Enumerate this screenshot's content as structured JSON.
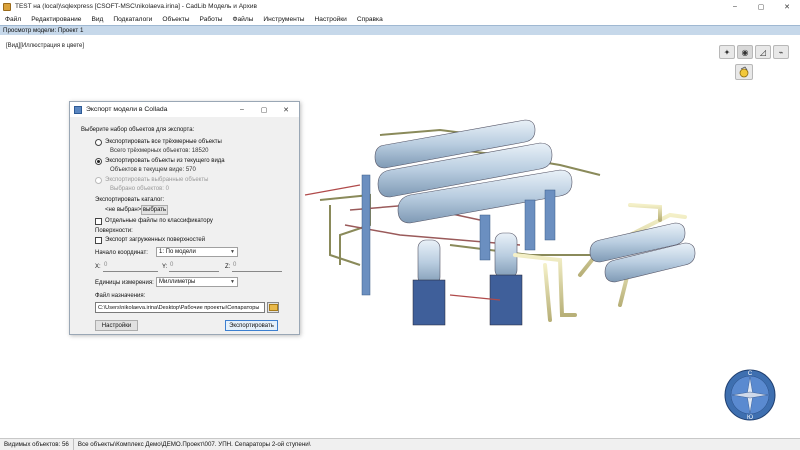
{
  "window": {
    "title": "TEST на (local)\\sqlexpress [CSOFT-MSC\\nikolaeva.irina] - CadLib Модель и Архив",
    "controls": [
      "–",
      "▢",
      "✕"
    ]
  },
  "menu": [
    "Файл",
    "Редактирование",
    "Вид",
    "Подкаталоги",
    "Объекты",
    "Работы",
    "Файлы",
    "Инструменты",
    "Настройки",
    "Справка"
  ],
  "viewport": {
    "header": "Просмотр модели: Проект 1",
    "label": "[Вид][Иллюстрация в цвете]"
  },
  "dialog": {
    "title": "Экспорт модели в Collada",
    "choose_label": "Выберите набор объектов для экспорта:",
    "opt_all": "Экспортировать все трёхмерные объекты",
    "opt_all_sub": "Всего трёхмерных объектов: 18520",
    "opt_view": "Экспортировать объекты из текущего вида",
    "opt_view_sub": "Объектов в текущем виде: 570",
    "opt_sel": "Экспортировать выбранные объекты",
    "opt_sel_sub": "Выбрано объектов: 0",
    "catalog_label": "Экспортировать каталог:",
    "catalog_value": "<не выбран>",
    "catalog_button": "выбрать",
    "separate_files": "Отдельные файлы по классификатору",
    "surfaces_label": "Поверхности:",
    "export_surfaces": "Экспорт загруженных поверхностей",
    "origin_label": "Начало координат:",
    "origin_value": "1: По модели",
    "x_label": "X:",
    "x_value": "0",
    "y_label": "Y:",
    "y_value": "0",
    "z_label": "Z:",
    "z_value": "0",
    "units_label": "Единицы измерения:",
    "units_value": "Миллиметры",
    "dest_label": "Файл назначения:",
    "dest_value": "C:\\Users\\nikolaeva.irina\\Desktop\\Рабочие проекты\\Сепараторы",
    "settings_button": "Настройки",
    "export_button": "Экспортировать"
  },
  "status": {
    "visible": "Видимых объектов: 56",
    "path": "Все объекты\\Комплекс Демо\\ДЕМО.Проект\\007. УПН. Сепараторы 2-ой ступени\\"
  },
  "compass": {
    "north": "C",
    "south": "Ю"
  }
}
